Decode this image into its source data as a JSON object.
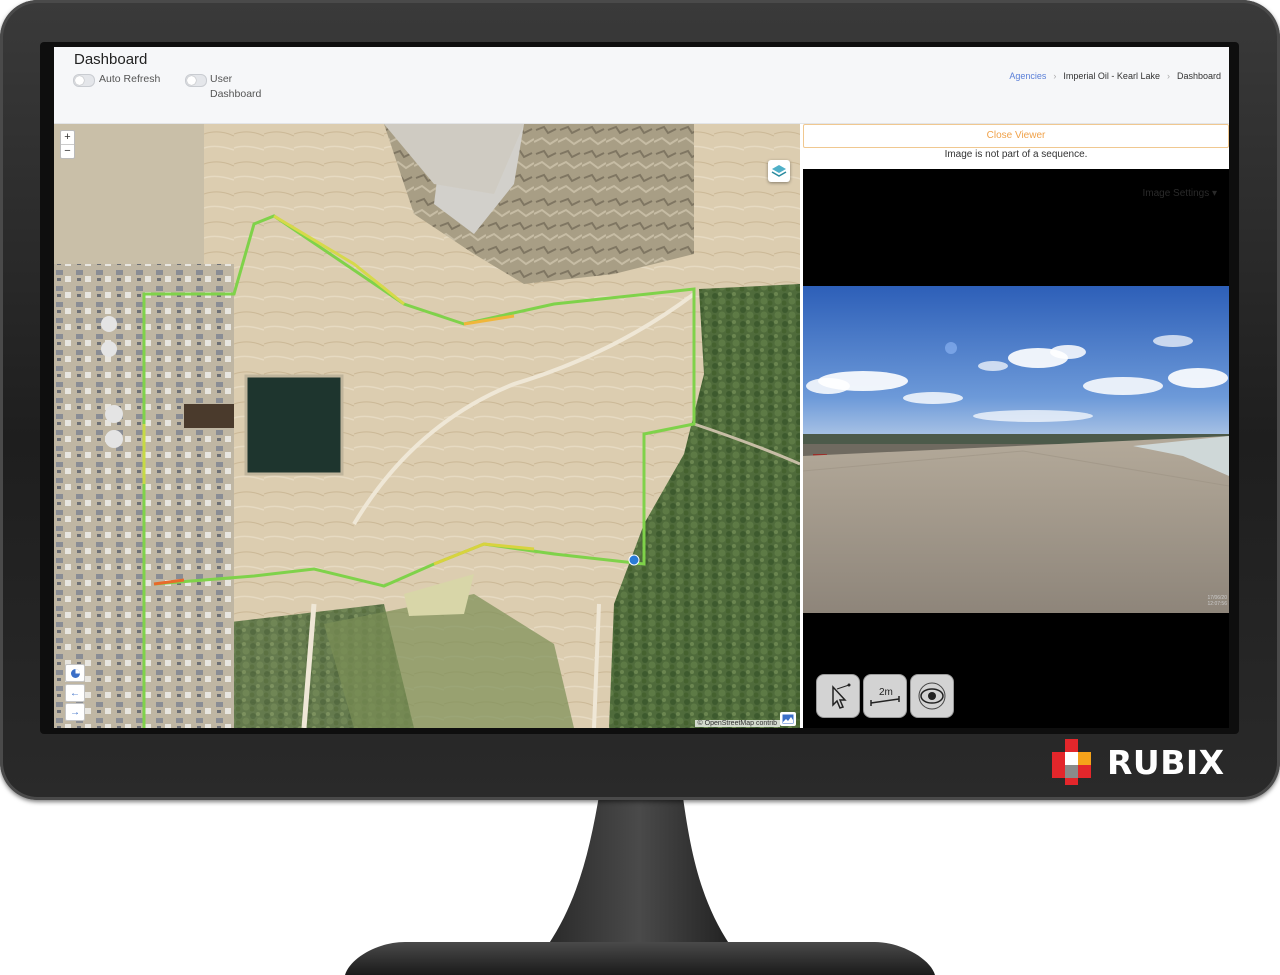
{
  "header": {
    "title": "Dashboard",
    "toggles": [
      {
        "label": "Auto Refresh",
        "on": false
      },
      {
        "label_line1": "User",
        "label_line2": "Dashboard",
        "on": false
      }
    ],
    "breadcrumb": [
      "Agencies",
      "Imperial Oil - Kearl Lake",
      "Dashboard"
    ]
  },
  "map": {
    "zoom_in": "+",
    "zoom_out": "−",
    "attribution": "© OpenStreetMap contrib",
    "icons": [
      "layers-icon",
      "pie-chart-icon",
      "arrow-left-icon",
      "arrow-right-icon",
      "image-toggle-icon"
    ]
  },
  "viewer": {
    "close_label": "Close Viewer",
    "sequence_message": "Image is not part of a sequence.",
    "image_settings": "Image Settings ▾",
    "timestamp_line1": "17/06/20",
    "timestamp_line2": "12:07:56",
    "tools": [
      "select-pointer-icon",
      "measure-2m-icon",
      "eye-icon"
    ],
    "measure_label": "2m"
  },
  "brand": {
    "logo_text": "RUBIX",
    "colors": {
      "red": "#e3262b",
      "orange": "#f5a21a",
      "grey": "#8a8a8a",
      "bezel": "#2a2a2a"
    }
  }
}
